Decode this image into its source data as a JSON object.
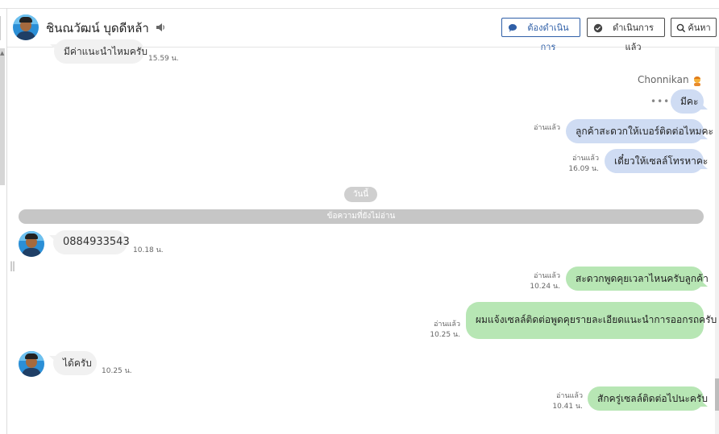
{
  "header": {
    "name": "ชินณวัฒน์ บุดดีหล้า",
    "buttons": {
      "todo": "ต้องดำเนินการ",
      "done": "ดำเนินการแล้ว",
      "search": "ค้นหา"
    }
  },
  "chat": {
    "day_separator": "วันนี้",
    "unread_separator": "ข้อความที่ยังไม่อ่าน",
    "agent_name": "Chonnikan",
    "messages": [
      {
        "side": "in",
        "text": "มีค่าแนะนำไหมครับ",
        "time": "15.59 น."
      },
      {
        "side": "out",
        "text": "มีคะ",
        "read": "",
        "time": ""
      },
      {
        "side": "out",
        "text": "ลูกค้าสะดวกให้เบอร์ติดต่อไหมคะ",
        "read": "อ่านแล้ว",
        "time": ""
      },
      {
        "side": "out",
        "text": "เดี๋ยวให้เซลล์โทรหาคะ",
        "read": "อ่านแล้ว",
        "time": "16.09 น."
      },
      {
        "side": "in",
        "text": "0884933543",
        "time": "10.18 น."
      },
      {
        "side": "out",
        "text": "สะดวกพูดคุยเวลาไหนครับลูกค้า",
        "read": "อ่านแล้ว",
        "time": "10.24 น."
      },
      {
        "side": "out",
        "text": "ผมแจ้งเซลล์ติดต่อพูดคุยรายละเอียดแนะนำการออกรถครับ",
        "read": "อ่านแล้ว",
        "time": "10.25 น."
      },
      {
        "side": "in",
        "text": "ได้ครับ",
        "time": "10.25 น."
      },
      {
        "side": "out",
        "text": "สักครู่เซลล์ติดต่อไปนะครับ",
        "read": "อ่านแล้ว",
        "time": "10.41 น."
      }
    ]
  },
  "icons": {
    "speaker": "speaker-icon",
    "todo": "chat-bubble-icon",
    "done": "check-bubble-icon",
    "search": "search-icon",
    "agent_emoji": "person-emoji-icon"
  },
  "colors": {
    "primary": "#2f5fa7",
    "bubble_blue": "#cfdcf3",
    "bubble_green": "#b7e6b4",
    "bubble_in": "#f1f1f1"
  }
}
